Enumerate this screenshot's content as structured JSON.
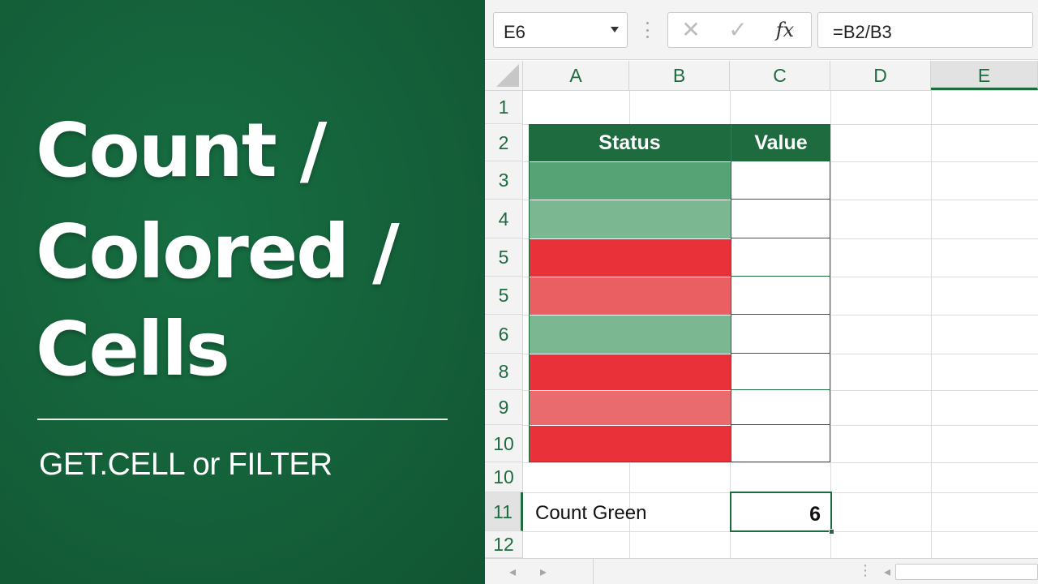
{
  "title": {
    "line1": "Count /",
    "line2": "Colored /",
    "line3": "Cells",
    "subtitle": "GET.CELL or FILTER"
  },
  "formula_bar": {
    "name_box": "E6",
    "cancel_icon": "✕",
    "enter_icon": "✓",
    "function_icon": "fx",
    "formula": "=B2/B3"
  },
  "columns": [
    "A",
    "B",
    "C",
    "D",
    "E"
  ],
  "selected_column": "E",
  "rows": [
    "1",
    "2",
    "3",
    "4",
    "5",
    "5",
    "6",
    "8",
    "9",
    "10",
    "10",
    "11",
    "12"
  ],
  "selected_row": "11",
  "table": {
    "header_status": "Status",
    "header_value": "Value",
    "status_colors": [
      "#56a476",
      "#7bb892",
      "#e9313a",
      "#ea5f62",
      "#7bb892",
      "#e9313a",
      "#ea6b6d",
      "#e9313a"
    ]
  },
  "summary": {
    "label": "Count Green",
    "value": "6"
  },
  "icons": {
    "name_box_dropdown": "chevron-down-icon",
    "select_all": "select-all-triangle",
    "scroll_prev": "◂",
    "scroll_next": "▸",
    "scroll_grip": "⋮",
    "hscroll_left": "◂"
  },
  "colors": {
    "brand_green": "#1e6b3f",
    "panel_green": "#14653c"
  }
}
